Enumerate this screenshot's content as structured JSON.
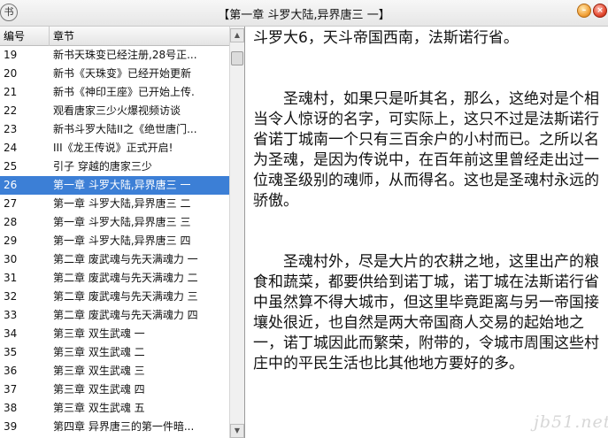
{
  "window": {
    "app_icon": "书",
    "title": "【第一章 斗罗大陆,异界唐三 一】"
  },
  "list": {
    "headers": {
      "num": "编号",
      "chapter": "章节"
    },
    "rows": [
      {
        "num": "19",
        "chapter": "新书天珠变已经注册,28号正..."
      },
      {
        "num": "20",
        "chapter": "新书《天珠变》已经开始更新"
      },
      {
        "num": "21",
        "chapter": "新书《神印王座》已开始上传."
      },
      {
        "num": "22",
        "chapter": "观看唐家三少火爆视频访谈"
      },
      {
        "num": "23",
        "chapter": "新书斗罗大陆II之《绝世唐门..."
      },
      {
        "num": "24",
        "chapter": "III《龙王传说》正式开启!"
      },
      {
        "num": "25",
        "chapter": "引子 穿越的唐家三少"
      },
      {
        "num": "26",
        "chapter": "第一章 斗罗大陆,异界唐三 一",
        "selected": true
      },
      {
        "num": "27",
        "chapter": "第一章 斗罗大陆,异界唐三 二"
      },
      {
        "num": "28",
        "chapter": "第一章 斗罗大陆,异界唐三 三"
      },
      {
        "num": "29",
        "chapter": "第一章 斗罗大陆,异界唐三 四"
      },
      {
        "num": "30",
        "chapter": "第二章 废武魂与先天满魂力 一"
      },
      {
        "num": "31",
        "chapter": "第二章 废武魂与先天满魂力 二"
      },
      {
        "num": "32",
        "chapter": "第二章 废武魂与先天满魂力 三"
      },
      {
        "num": "33",
        "chapter": "第二章 废武魂与先天满魂力 四"
      },
      {
        "num": "34",
        "chapter": "第三章 双生武魂 一"
      },
      {
        "num": "35",
        "chapter": "第三章 双生武魂 二"
      },
      {
        "num": "36",
        "chapter": "第三章 双生武魂 三"
      },
      {
        "num": "37",
        "chapter": "第三章 双生武魂 四"
      },
      {
        "num": "38",
        "chapter": "第三章 双生武魂 五"
      },
      {
        "num": "39",
        "chapter": "第四章 异界唐三的第一件暗..."
      }
    ]
  },
  "reader": {
    "paragraphs": [
      {
        "text": "斗罗大6，天斗帝国西南，法斯诺行省。",
        "indent": false
      },
      {
        "text": "圣魂村，如果只是听其名，那么，这绝对是个相当令人惊讶的名字，可实际上，这只不过是法斯诺行省诺丁城南一个只有三百余户的小村而已。之所以名为圣魂，是因为传说中，在百年前这里曾经走出过一位魂圣级别的魂师，从而得名。这也是圣魂村永远的骄傲。",
        "indent": true
      },
      {
        "text": "圣魂村外，尽是大片的农耕之地，这里出产的粮食和蔬菜，都要供给到诺丁城，诺丁城在法斯诺行省中虽然算不得大城市，但这里毕竟距离与另一帝国接壤处很近，也自然是两大帝国商人交易的起始地之一，诺丁城因此而繁荣，附带的，令城市周围这些村庄中的平民生活也比其他地方要好的多。",
        "indent": true
      }
    ]
  },
  "watermark": "jb51.net",
  "colors": {
    "selection": "#3c7fd6",
    "minimize": "#f2a23a",
    "close": "#e44a31"
  }
}
